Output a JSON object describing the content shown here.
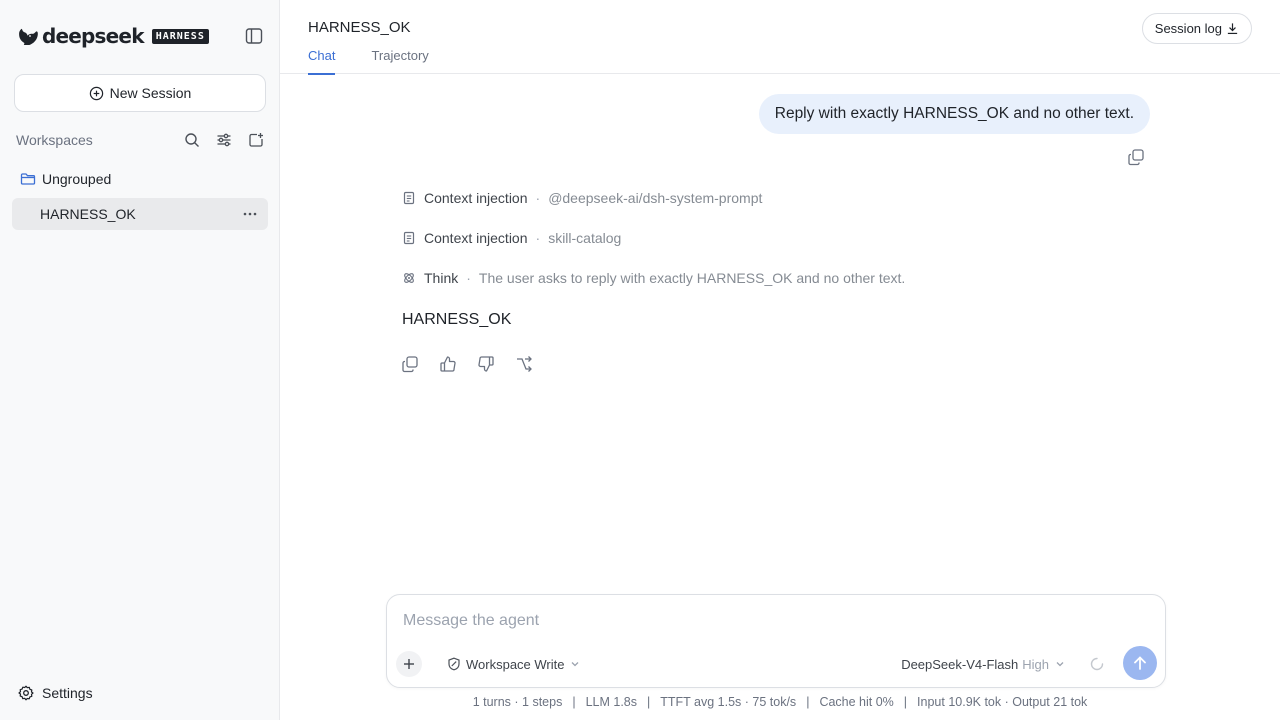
{
  "sidebar": {
    "logo_text": "deepseek",
    "logo_badge": "HARNESS",
    "new_session_label": "New Session",
    "workspaces_label": "Workspaces",
    "group_label": "Ungrouped",
    "sessions": [
      {
        "title": "HARNESS_OK",
        "selected": true
      }
    ],
    "settings_label": "Settings"
  },
  "header": {
    "title": "HARNESS_OK",
    "tabs": [
      {
        "label": "Chat",
        "active": true
      },
      {
        "label": "Trajectory",
        "active": false
      }
    ],
    "session_log_label": "Session log"
  },
  "chat": {
    "user_message": "Reply with exactly HARNESS_OK and no other text.",
    "steps": [
      {
        "icon": "document-icon",
        "label": "Context injection",
        "detail": "@deepseek-ai/dsh-system-prompt"
      },
      {
        "icon": "document-icon",
        "label": "Context injection",
        "detail": "skill-catalog"
      },
      {
        "icon": "think-icon",
        "label": "Think",
        "detail": "The user asks to reply with exactly HARNESS_OK and no other text."
      }
    ],
    "assistant_answer": "HARNESS_OK"
  },
  "composer": {
    "placeholder": "Message the agent",
    "mode_label": "Workspace Write",
    "model_label": "DeepSeek-V4-Flash",
    "effort_label": "High"
  },
  "stats": {
    "turns": "1 turns · 1 steps",
    "llm": "LLM 1.8s",
    "ttft": "TTFT avg 1.5s · 75 tok/s",
    "cache": "Cache hit 0%",
    "tokens": "Input 10.9K tok · Output 21 tok"
  },
  "colors": {
    "accent": "#3b6fd4",
    "user_bubble": "#e8f0fc",
    "send_button": "#9bb7f0",
    "sidebar_bg": "#f8f9fa"
  }
}
